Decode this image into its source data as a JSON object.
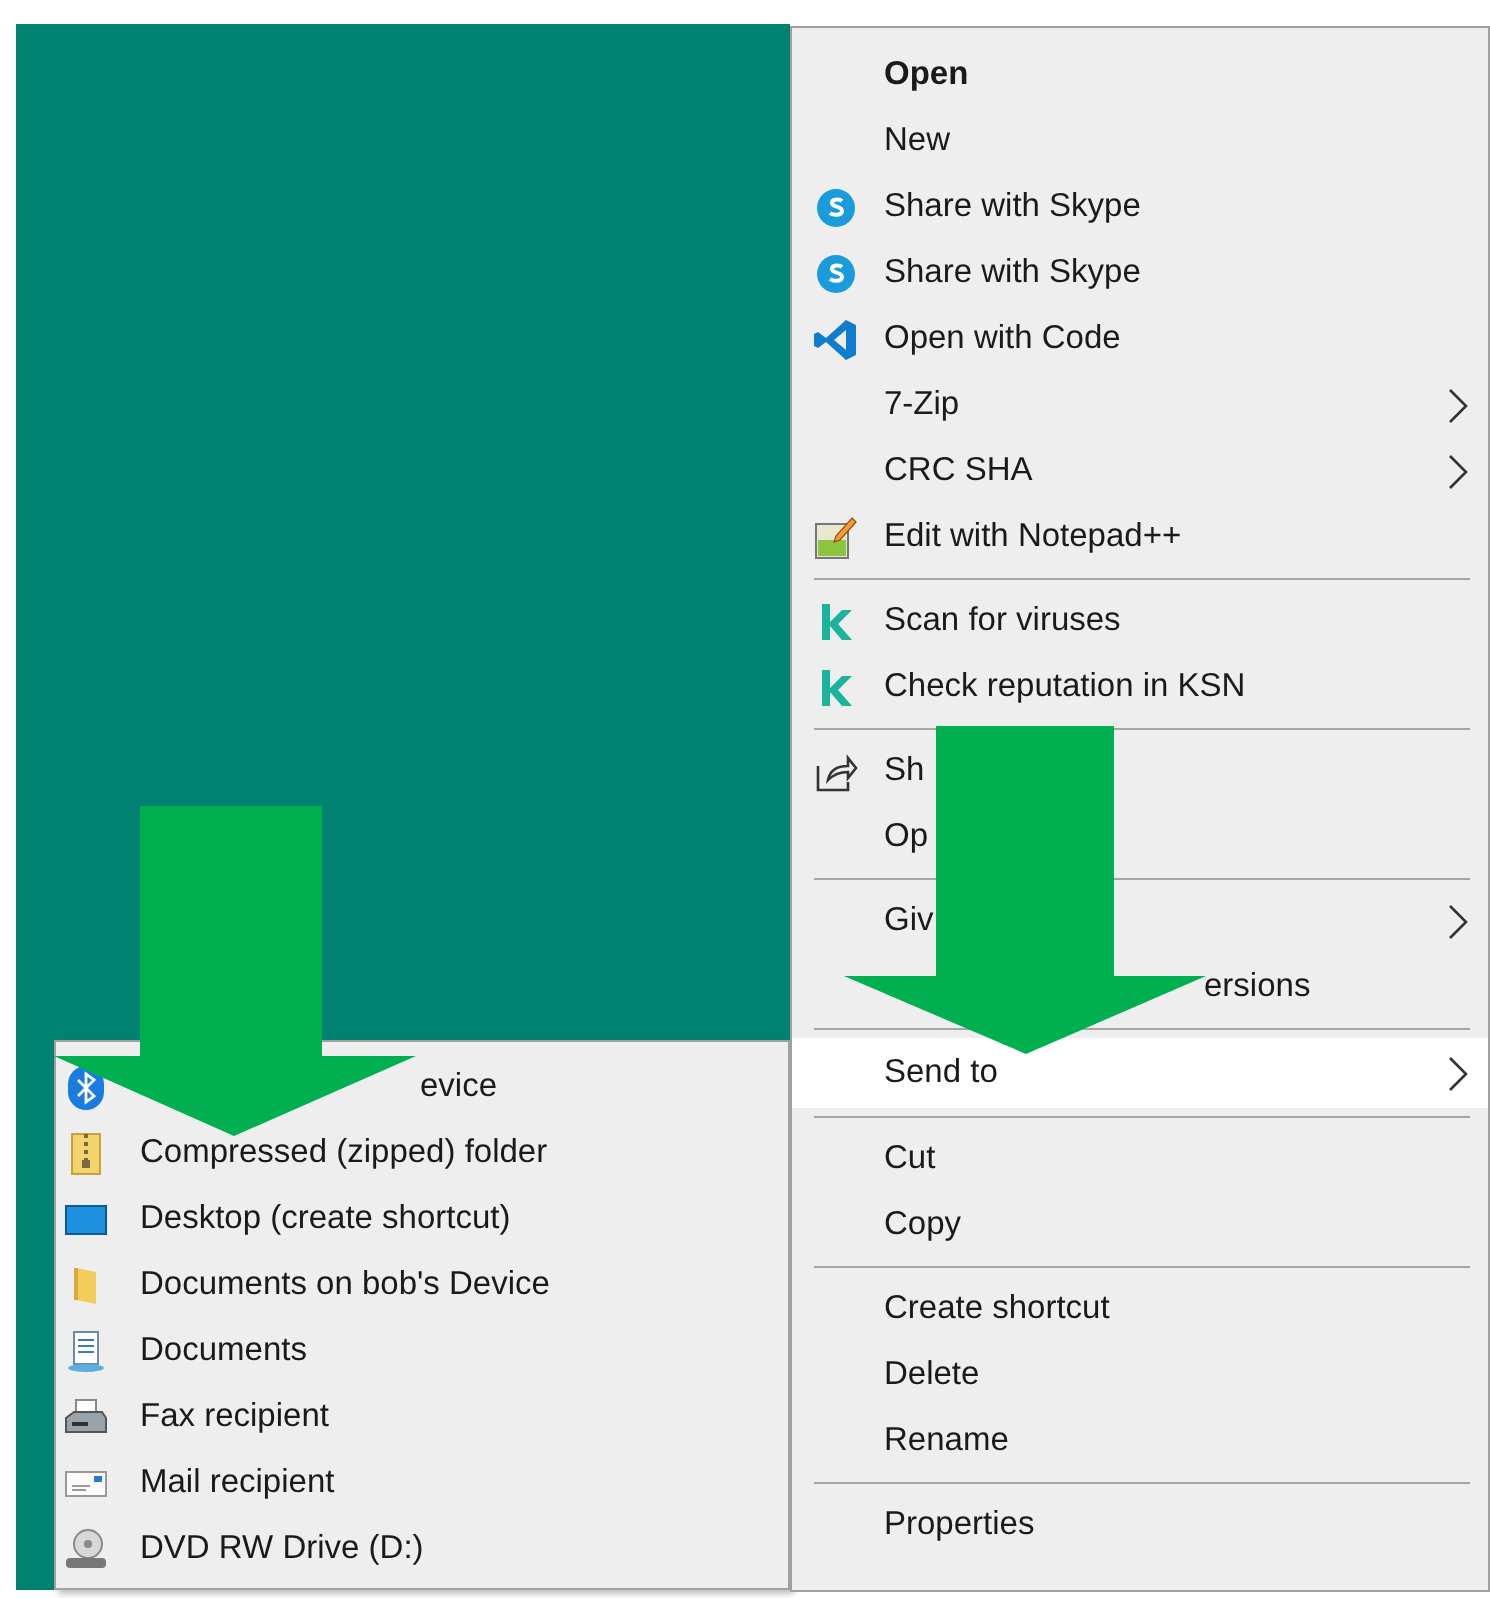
{
  "context_menu": {
    "items": [
      {
        "kind": "item",
        "label": "Open",
        "default": true,
        "submenu": false,
        "selected": false
      },
      {
        "kind": "item",
        "label": "New",
        "submenu": false,
        "selected": false
      },
      {
        "kind": "item",
        "label": "Share with Skype",
        "submenu": false,
        "selected": false
      },
      {
        "kind": "item",
        "label": "Share with Skype",
        "submenu": false,
        "selected": false
      },
      {
        "kind": "item",
        "label": "Open with Code",
        "submenu": false,
        "selected": false
      },
      {
        "kind": "item",
        "label": "7-Zip",
        "submenu": true,
        "selected": false
      },
      {
        "kind": "item",
        "label": "CRC SHA",
        "submenu": true,
        "selected": false
      },
      {
        "kind": "item",
        "label": "Edit with Notepad++",
        "submenu": false,
        "selected": false
      },
      {
        "kind": "separator"
      },
      {
        "kind": "item",
        "label": "Scan for viruses",
        "submenu": false,
        "selected": false
      },
      {
        "kind": "item",
        "label": "Check reputation in KSN",
        "submenu": false,
        "selected": false
      },
      {
        "kind": "separator"
      },
      {
        "kind": "item",
        "label": "Sh",
        "submenu": false,
        "selected": false
      },
      {
        "kind": "item",
        "label": "Op",
        "submenu": false,
        "selected": false
      },
      {
        "kind": "separator"
      },
      {
        "kind": "item",
        "label": "Giv",
        "submenu": true,
        "selected": false
      },
      {
        "kind": "tail",
        "label": "ersions",
        "submenu": false,
        "selected": false
      },
      {
        "kind": "separator"
      },
      {
        "kind": "item",
        "label": "Send to",
        "submenu": true,
        "selected": true
      },
      {
        "kind": "separator"
      },
      {
        "kind": "item",
        "label": "Cut",
        "submenu": false,
        "selected": false
      },
      {
        "kind": "item",
        "label": "Copy",
        "submenu": false,
        "selected": false
      },
      {
        "kind": "separator"
      },
      {
        "kind": "item",
        "label": "Create shortcut",
        "submenu": false,
        "selected": false
      },
      {
        "kind": "item",
        "label": "Delete",
        "submenu": false,
        "selected": false
      },
      {
        "kind": "item",
        "label": "Rename",
        "submenu": false,
        "selected": false
      },
      {
        "kind": "separator"
      },
      {
        "kind": "item",
        "label": "Properties",
        "submenu": false,
        "selected": false
      }
    ]
  },
  "send_to_menu": {
    "items": [
      {
        "kind": "tail",
        "label": "evice",
        "selected": false
      },
      {
        "kind": "item",
        "label": "Compressed (zipped) folder",
        "selected": false
      },
      {
        "kind": "item",
        "label": "Desktop (create shortcut)",
        "selected": false
      },
      {
        "kind": "item",
        "label": "Documents on bob's Device",
        "selected": false
      },
      {
        "kind": "item",
        "label": "Documents",
        "selected": false
      },
      {
        "kind": "item",
        "label": "Fax recipient",
        "selected": false
      },
      {
        "kind": "item",
        "label": "Mail recipient",
        "selected": false
      },
      {
        "kind": "item",
        "label": "DVD RW Drive (D:)",
        "selected": false
      }
    ]
  }
}
